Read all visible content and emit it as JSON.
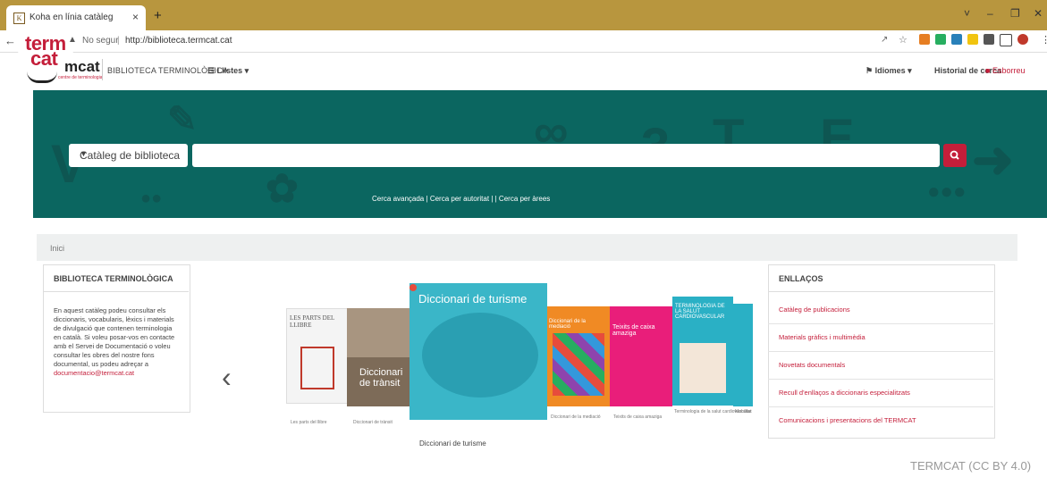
{
  "browser": {
    "tab_title": "Koha en línia catàleg",
    "tab_icon": "K",
    "tab_close": "×",
    "new_tab": "+",
    "not_secure": "No segur",
    "url": "http://biblioteca.termcat.cat",
    "window_controls": [
      "˅",
      "–",
      "❐",
      "✕"
    ]
  },
  "logo": {
    "line1": "term",
    "line2": "cat",
    "wordmark": "mcat",
    "subtitle": "centre de terminologia"
  },
  "nav": {
    "site_name": "BIBLIOTECA TERMINOLÒGICA",
    "lists": "Llistes",
    "languages": "Idiomes",
    "history": "Historial de cerca",
    "clear": "Esborreu"
  },
  "search": {
    "catalog_select": "Catàleg de biblioteca",
    "query": "",
    "advanced": "Cerca avançada",
    "authority": "Cerca per autoritat",
    "areas": "Cerca per àrees"
  },
  "breadcrumb": "Inici",
  "left_panel": {
    "title": "BIBLIOTECA TERMINOLÒGICA",
    "text": "En aquest catàleg podeu consultar els diccionaris, vocabularis, lèxics i materials de divulgació que contenen terminologia en català. Si voleu posar-vos en contacte amb el Servei de Documentació o voleu consultar les obres del nostre fons documental, us podeu adreçar a ",
    "email": "documentacio@termcat.cat"
  },
  "carousel": {
    "main_title": "Diccionari de turisme",
    "main_caption": "Diccionari de turisme",
    "book1_title": "LES PARTS DEL LLIBRE",
    "book2_title": "Diccionari de trànsit",
    "book4_title": "Diccionari de la mediació",
    "book5_title": "Teixits de caixa amaziga",
    "book6_title": "TERMINOLOGIA DE LA SALUT CARDIOVASCULAR",
    "captions": [
      "Les parts del llibre",
      "Diccionari de trànsit",
      "Diccionari de la mediació",
      "Teixits de caixa amaziga",
      "Terminologia de la salut cardiovascular",
      "Mobilitat"
    ]
  },
  "right_panel": {
    "title": "ENLLAÇOS",
    "links": [
      "Catàleg de publicacions",
      "Materials gràfics i multimèdia",
      "Novetats documentals",
      "Recull d'enllaços a diccionaris especialitzats",
      "Comunicacions i presentacions del TERMCAT"
    ]
  },
  "credit": "TERMCAT (CC BY 4.0)",
  "colors": {
    "brand_red": "#c41e3a",
    "hero_teal": "#0b6660",
    "tab_bar": "#b8963e"
  }
}
